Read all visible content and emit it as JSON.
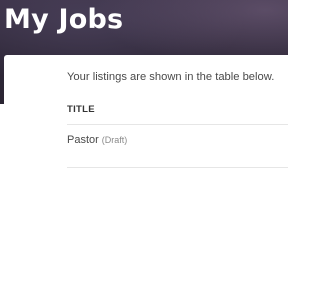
{
  "header": {
    "title": "My Jobs"
  },
  "main": {
    "intro_text": "Your listings are shown in the table below.",
    "table": {
      "columns": [
        "TITLE"
      ],
      "rows": [
        {
          "title": "Pastor",
          "status": "(Draft)"
        }
      ]
    }
  },
  "colors": {
    "hero_background": "#2f2839",
    "text": "#4a4a4a",
    "muted": "#8a8a8a",
    "divider": "#e6e6e6"
  }
}
